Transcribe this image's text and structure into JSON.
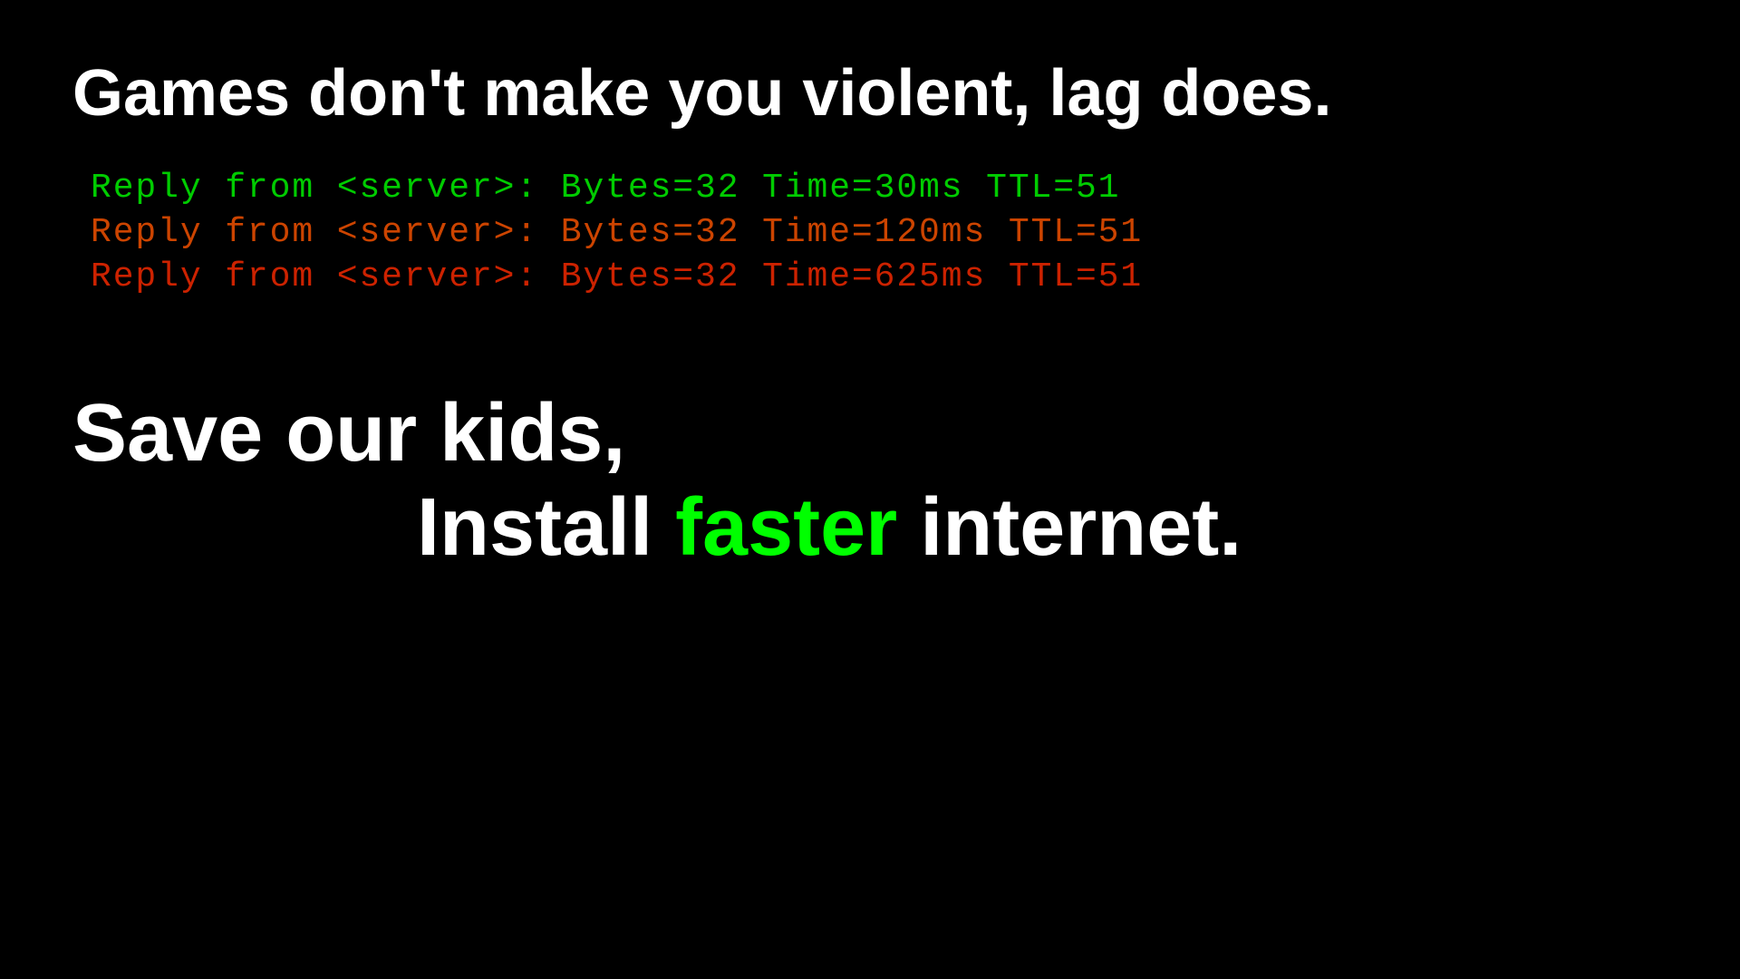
{
  "header": {
    "tagline": "Games don't make you violent, lag does."
  },
  "ping_results": {
    "line1": {
      "text": "Reply from <server>: Bytes=32 Time=30ms TTL=51",
      "color_class": "ping-good"
    },
    "line2": {
      "text": "Reply from <server>: Bytes=32 Time=120ms TTL=51",
      "color_class": "ping-medium"
    },
    "line3": {
      "text": "Reply from <server>: Bytes=32 Time=625ms TTL=51",
      "color_class": "ping-bad"
    }
  },
  "cta": {
    "line1": "Save our kids,",
    "line2_prefix": "Install ",
    "line2_highlight": "faster",
    "line2_suffix": " internet."
  }
}
